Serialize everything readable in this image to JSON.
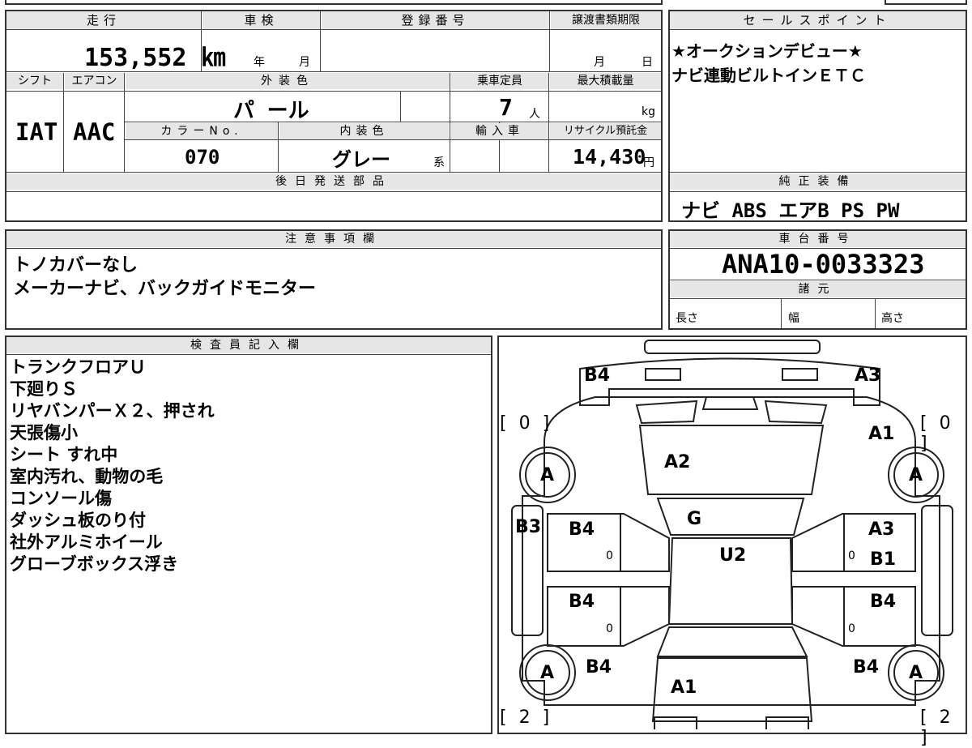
{
  "headers": {
    "mileage": "走行",
    "shaken": "車検",
    "reg_no": "登録番号",
    "deadline": "譲渡書類期限",
    "sales_point": "セールスポイント",
    "shift": "シフト",
    "aircon": "エアコン",
    "exterior_color": "外装色",
    "capacity": "乗車定員",
    "max_load": "最大積載量",
    "color_no": "カラーNo.",
    "interior_color": "内装色",
    "import": "輸入車",
    "recycle": "リサイクル預託金",
    "later_parts": "後日発送部品",
    "genuine_equipment": "純正装備",
    "caution": "注意事項欄",
    "chassis_no": "車台番号",
    "specs": "諸元",
    "inspector": "検査員記入欄"
  },
  "values": {
    "mileage_value": "153,552 ㎞",
    "shaken_year": "年",
    "shaken_month": "月",
    "deadline_month": "月",
    "deadline_day": "日",
    "shift_value": "IAT",
    "aircon_value": "AAC",
    "exterior_color_value": "パ ール",
    "capacity_value": "7",
    "capacity_unit": "人",
    "max_load_unit": "kg",
    "color_no_value": "070",
    "interior_color_value": "グレー",
    "interior_color_suffix": "系",
    "recycle_value": "14,430",
    "recycle_unit": "円",
    "genuine_equipment_value": "ナビ ABS エアB PS PW",
    "chassis_no_value": "ANA10-0033323",
    "spec_length": "長さ",
    "spec_width": "幅",
    "spec_height": "高さ"
  },
  "sales_points": [
    "★オークションデビュー★",
    "ナビ連動ビルトインＥＴＣ"
  ],
  "caution_lines": [
    "トノカバーなし",
    "メーカーナビ、バックガイドモニター"
  ],
  "inspector_lines": [
    "トランクフロアＵ",
    "下廻りＳ",
    "リヤバンパーＸ２、押され",
    "天張傷小",
    "シート すれ中",
    "室内汚れ、動物の毛",
    "コンソール傷",
    "ダッシュ板のり付",
    "社外アルミホイール",
    "グローブボックス浮き"
  ],
  "diagram": {
    "top_left": "[ 0 ]",
    "top_right": "[ 0 ]",
    "bottom_left": "[ 2 ]",
    "bottom_right": "[ 2 ]",
    "wheel": "A",
    "labels": {
      "rear_left": "B4",
      "rear_right": "A3",
      "roof_rear_right": "A1",
      "rear_glass": "A2",
      "glass": "G",
      "roof": "U2",
      "left_quarter": "B3",
      "left_rear_door": "B4",
      "left_front_door": "B4",
      "left_fender": "B4",
      "right_quarter": "A3",
      "right_quarter_b": "B1",
      "right_rear_door": "B4",
      "right_fender": "B4",
      "hood": "A1",
      "zero": "0"
    }
  }
}
